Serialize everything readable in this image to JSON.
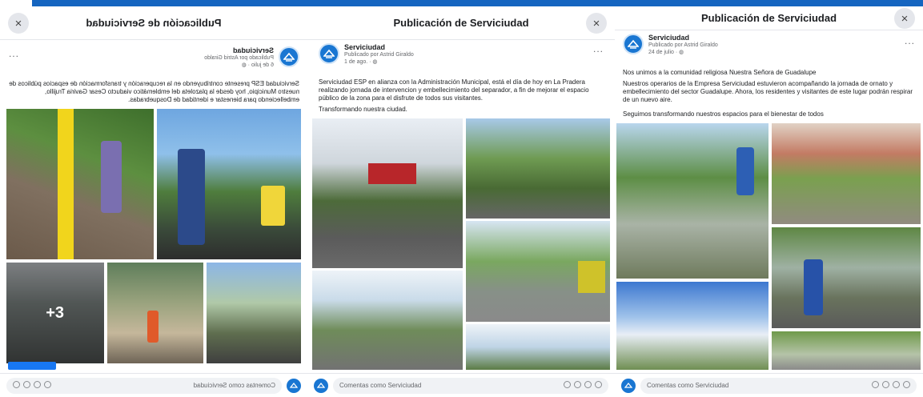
{
  "panels": [
    {
      "title": "Publicación de Serviciudad",
      "close": "×",
      "author": "Serviciudad",
      "published_by": "Publicado por Astrid Giraldo",
      "date": "6 de julio · ",
      "text": "Serviciudad ESP presente contribuyendo en la recuperación y transformación de espacios públicos de nuestro Municipio, hoy desde la plazoleta del emblemático viaducto Cesar Gaviria Trujillo, embelleciendo para bienestar e identidad de Dosquebradas.",
      "more_photos": "+3",
      "comment_placeholder": "Comentas como Serviciudad",
      "menu": "..."
    },
    {
      "title": "Publicación de Serviciudad",
      "close": "×",
      "author": "Serviciudad",
      "published_by": "Publicado por Astrid Giraldo",
      "date": "1 de ago. · ",
      "text": "Serviciudad ESP  en alianza con la Administración Municipal, está el día de hoy en La Pradera realizando jornada de intervencion y embellecimiento del separador, a fin de mejorar el espacio público de la zona para el disfrute de todos sus visitantes.",
      "text2": "Transformando nuestra ciudad.",
      "comment_placeholder": "Comentas como Serviciudad",
      "menu": "..."
    },
    {
      "title": "Publicación de Serviciudad",
      "close": "×",
      "author": "Serviciudad",
      "published_by": "Publicado por Astrid Giraldo",
      "date": "24 de julio · ",
      "text": "Nos unimos a la comunidad religiosa Nuestra Señora de Guadalupe",
      "text2": "Nuestros operarios de la Empresa Serviciudad estuvieron acompañando la jornada de ornato y embellecimiento del sector Guadalupe. Ahora, los residentes y visitantes de este lugar podrán respirar de un nuevo aire.",
      "text3": "Seguimos transformando nuestros espacios para el bienestar de todos",
      "comment_placeholder": "Comentas como Serviciudad",
      "menu": "..."
    }
  ],
  "colors": {
    "brand": "#1976d2",
    "accent": "#1565c0"
  },
  "icons": [
    "close-icon",
    "avatar-logo-icon",
    "more-options-icon",
    "globe-icon",
    "emoji-icon",
    "camera-icon",
    "gif-icon",
    "sticker-icon"
  ]
}
